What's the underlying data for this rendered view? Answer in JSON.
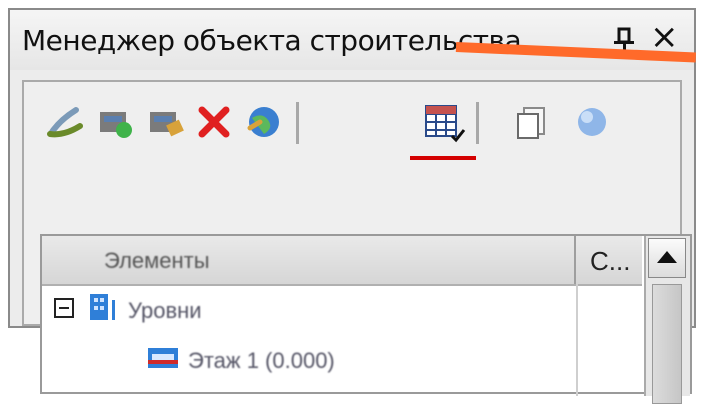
{
  "window": {
    "title": "Менеджер объекта строительства",
    "pin_glyph": "pin-icon",
    "close_glyph": "×"
  },
  "toolbar": {
    "buttons": [
      {
        "icon": "wand-edit-icon"
      },
      {
        "icon": "add-level-icon"
      },
      {
        "icon": "edit-level-icon"
      },
      {
        "icon": "delete-icon"
      },
      {
        "icon": "globe-settings-icon"
      },
      {
        "icon": "table-grid-icon",
        "highlighted": true
      },
      {
        "icon": "copy-page-icon"
      },
      {
        "icon": "sphere-icon"
      }
    ]
  },
  "grid": {
    "columns": [
      "Элементы",
      "С..."
    ],
    "rows": [
      {
        "label": "Уровни",
        "expanded": true,
        "icon": "building-icon"
      },
      {
        "label": "Этаж 1 (0.000)",
        "icon": "floor-icon"
      }
    ]
  },
  "colors": {
    "highlight_underline": "#d40000",
    "annotation_arrow": "#ff6a2a",
    "panel_bg": "#ececec"
  }
}
